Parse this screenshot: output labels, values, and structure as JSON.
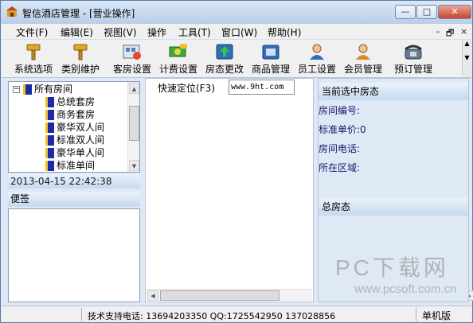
{
  "window": {
    "title": "智信酒店管理 - [营业操作]",
    "minimize": "—",
    "maximize": "□",
    "close": "✕"
  },
  "menu": [
    "文件(F)",
    "编辑(E)",
    "视图(V)",
    "操作",
    "工具(T)",
    "窗口(W)",
    "帮助(H)"
  ],
  "mdi_controls": {
    "minimize": "–",
    "restore": "🗗",
    "close": "×"
  },
  "toolbar": [
    {
      "label": "系统选项",
      "icon": "hammer-icon"
    },
    {
      "label": "类别维护",
      "icon": "hammer-icon"
    },
    {
      "label": "客房设置",
      "icon": "rooms-icon"
    },
    {
      "label": "计费设置",
      "icon": "money-icon"
    },
    {
      "label": "房态更改",
      "icon": "room-status-icon"
    },
    {
      "label": "商品管理",
      "icon": "goods-icon"
    },
    {
      "label": "员工设置",
      "icon": "user-icon"
    },
    {
      "label": "会员管理",
      "icon": "member-icon"
    },
    {
      "label": "预订管理",
      "icon": "phone-icon"
    }
  ],
  "tree": {
    "root": "所有房间",
    "expander": "−",
    "items": [
      "总统套房",
      "商务套房",
      "豪华双人间",
      "标准双人间",
      "豪华单人间",
      "标准单间"
    ]
  },
  "datetime": "2013-04-15 22:42:38",
  "note_label": "便签",
  "quick_locate": {
    "label": "快速定位(F3)",
    "value": "www.9ht.com"
  },
  "current_room": {
    "header": "当前选中房态",
    "fields": [
      "房间编号:",
      "标准单价:0",
      "房间电话:",
      "所在区域:"
    ]
  },
  "all_status_header": "总房态",
  "statusbar": {
    "tech_support": "技术支持电话: 13694203350 QQ:1725542950 137028856",
    "version": "单机版"
  },
  "watermark": {
    "main": "PC下载网",
    "sub": "www.pcsoft.com.cn"
  }
}
